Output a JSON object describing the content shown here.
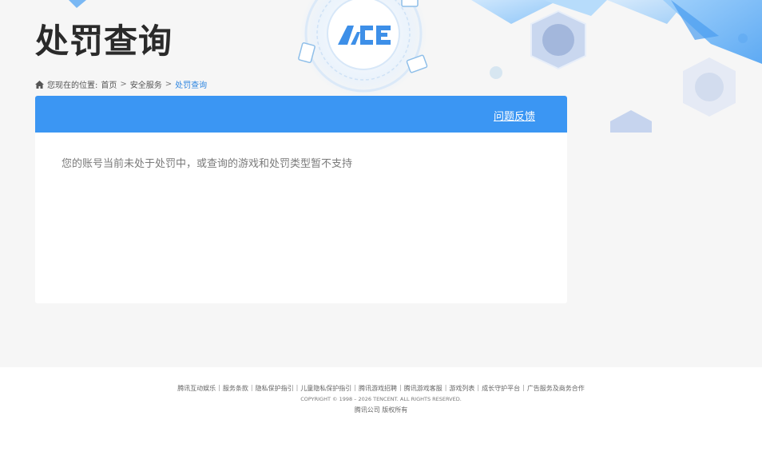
{
  "header": {
    "title": "处罚查询",
    "logo_text": "ACE"
  },
  "breadcrumb": {
    "prefix": "您现在的位置:",
    "items": [
      "首页",
      "安全服务",
      "处罚查询"
    ],
    "separator": ">"
  },
  "panel": {
    "feedback_label": "问题反馈",
    "message": "您的账号当前未处于处罚中，或查询的游戏和处罚类型暂不支持"
  },
  "footer": {
    "links": [
      "腾讯互动娱乐",
      "服务条款",
      "隐私保护指引",
      "儿童隐私保护指引",
      "腾讯游戏招聘",
      "腾讯游戏客服",
      "游戏列表",
      "成长守护平台",
      "广告服务及商务合作"
    ],
    "copyright": "COPYRIGHT © 1998 – 2026 TENCENT. ALL RIGHTS RESERVED.",
    "company": "腾讯公司 版权所有"
  },
  "colors": {
    "accent": "#3b96f3",
    "current_breadcrumb": "#2f86e0",
    "background": "#f6f6f6"
  }
}
